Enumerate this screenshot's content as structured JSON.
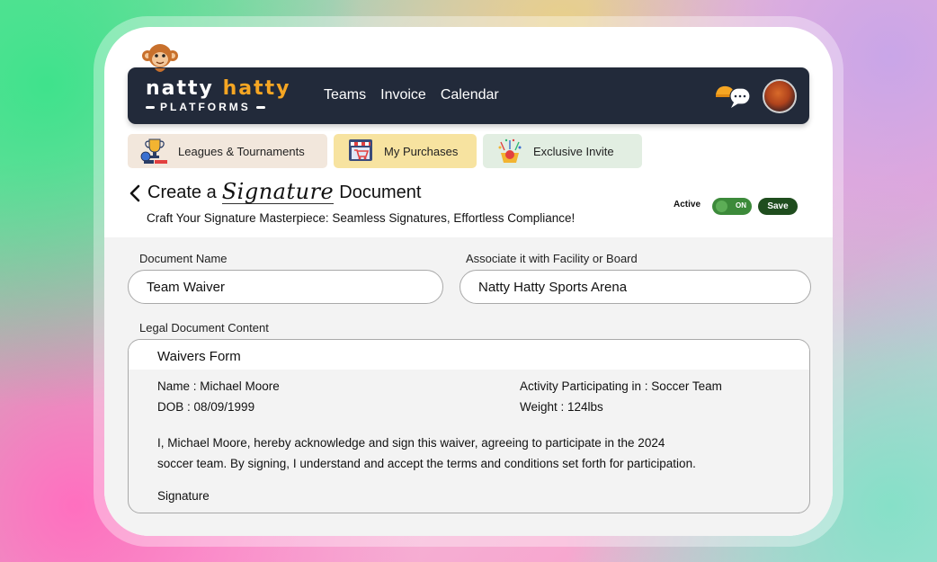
{
  "brand": {
    "name_part1": "natty",
    "name_part2": "hatty",
    "tagline": "PLATFORMS"
  },
  "nav": {
    "links": [
      "Teams",
      "Invoice",
      "Calendar"
    ]
  },
  "tabs": [
    {
      "label": "Leagues & Tournaments",
      "icon": "trophy-icon"
    },
    {
      "label": "My Purchases",
      "icon": "shop-icon"
    },
    {
      "label": "Exclusive Invite",
      "icon": "party-icon"
    }
  ],
  "page": {
    "title_prefix": "Create a",
    "title_script": "Signature",
    "title_suffix": "Document",
    "subtitle": "Craft Your Signature Masterpiece: Seamless Signatures, Effortless Compliance!",
    "active_label": "Active",
    "toggle_state": "ON",
    "save_label": "Save"
  },
  "form": {
    "document_name_label": "Document Name",
    "document_name_value": "Team Waiver",
    "associate_label": "Associate it with Facility or Board",
    "associate_value": "Natty Hatty Sports Arena",
    "content_label": "Legal Document Content"
  },
  "document": {
    "heading": "Waivers Form",
    "name": "Name : Michael Moore",
    "dob": "DOB : 08/09/1999",
    "activity": "Activity Participating in : Soccer Team",
    "weight": "Weight : 124lbs",
    "paragraph_line1": "I, Michael Moore, hereby acknowledge and sign this waiver, agreeing to participate in the 2024",
    "paragraph_line2": "soccer team. By signing, I understand and accept the terms and conditions set forth for participation.",
    "signature_label": "Signature"
  },
  "colors": {
    "navbar_bg": "#222a3a",
    "brand_accent": "#f6a623",
    "toggle_green": "#3c8a3a",
    "save_green": "#1f4d1e"
  }
}
